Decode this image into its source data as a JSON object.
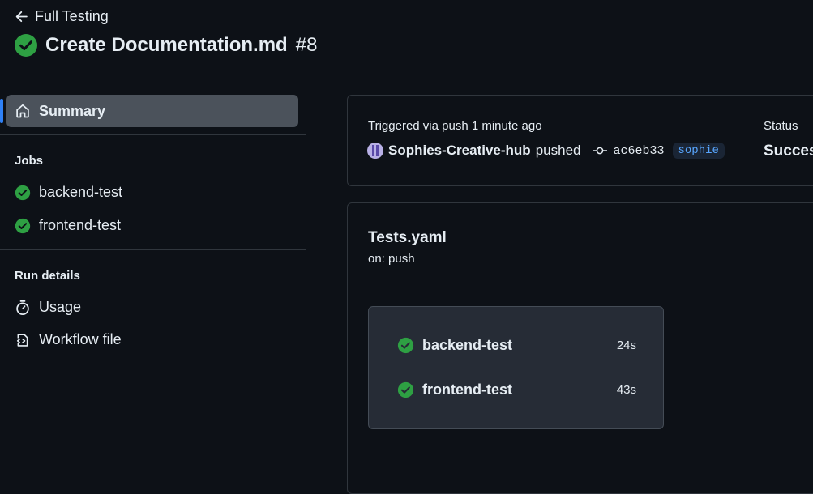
{
  "header": {
    "back_label": "Full Testing",
    "title": "Create Documentation.md",
    "run_number": "#8"
  },
  "sidebar": {
    "summary_label": "Summary",
    "jobs_heading": "Jobs",
    "jobs": [
      {
        "label": "backend-test",
        "status": "success"
      },
      {
        "label": "frontend-test",
        "status": "success"
      }
    ],
    "run_details_heading": "Run details",
    "details": [
      {
        "label": "Usage",
        "icon": "stopwatch-icon"
      },
      {
        "label": "Workflow file",
        "icon": "file-code-icon"
      }
    ]
  },
  "trigger": {
    "label": "Triggered via push 1 minute ago",
    "actor": "Sophies-Creative-hub",
    "action": "pushed",
    "commit": "ac6eb33",
    "branch": "sophie",
    "status_label": "Status",
    "status_value": "Succes"
  },
  "workflow": {
    "name": "Tests.yaml",
    "on": "on: push",
    "jobs": [
      {
        "label": "backend-test",
        "duration": "24s"
      },
      {
        "label": "frontend-test",
        "duration": "43s"
      }
    ]
  },
  "colors": {
    "background": "#0d1117",
    "success": "#2ea043",
    "accent": "#2f81f7",
    "border": "#30363d"
  }
}
